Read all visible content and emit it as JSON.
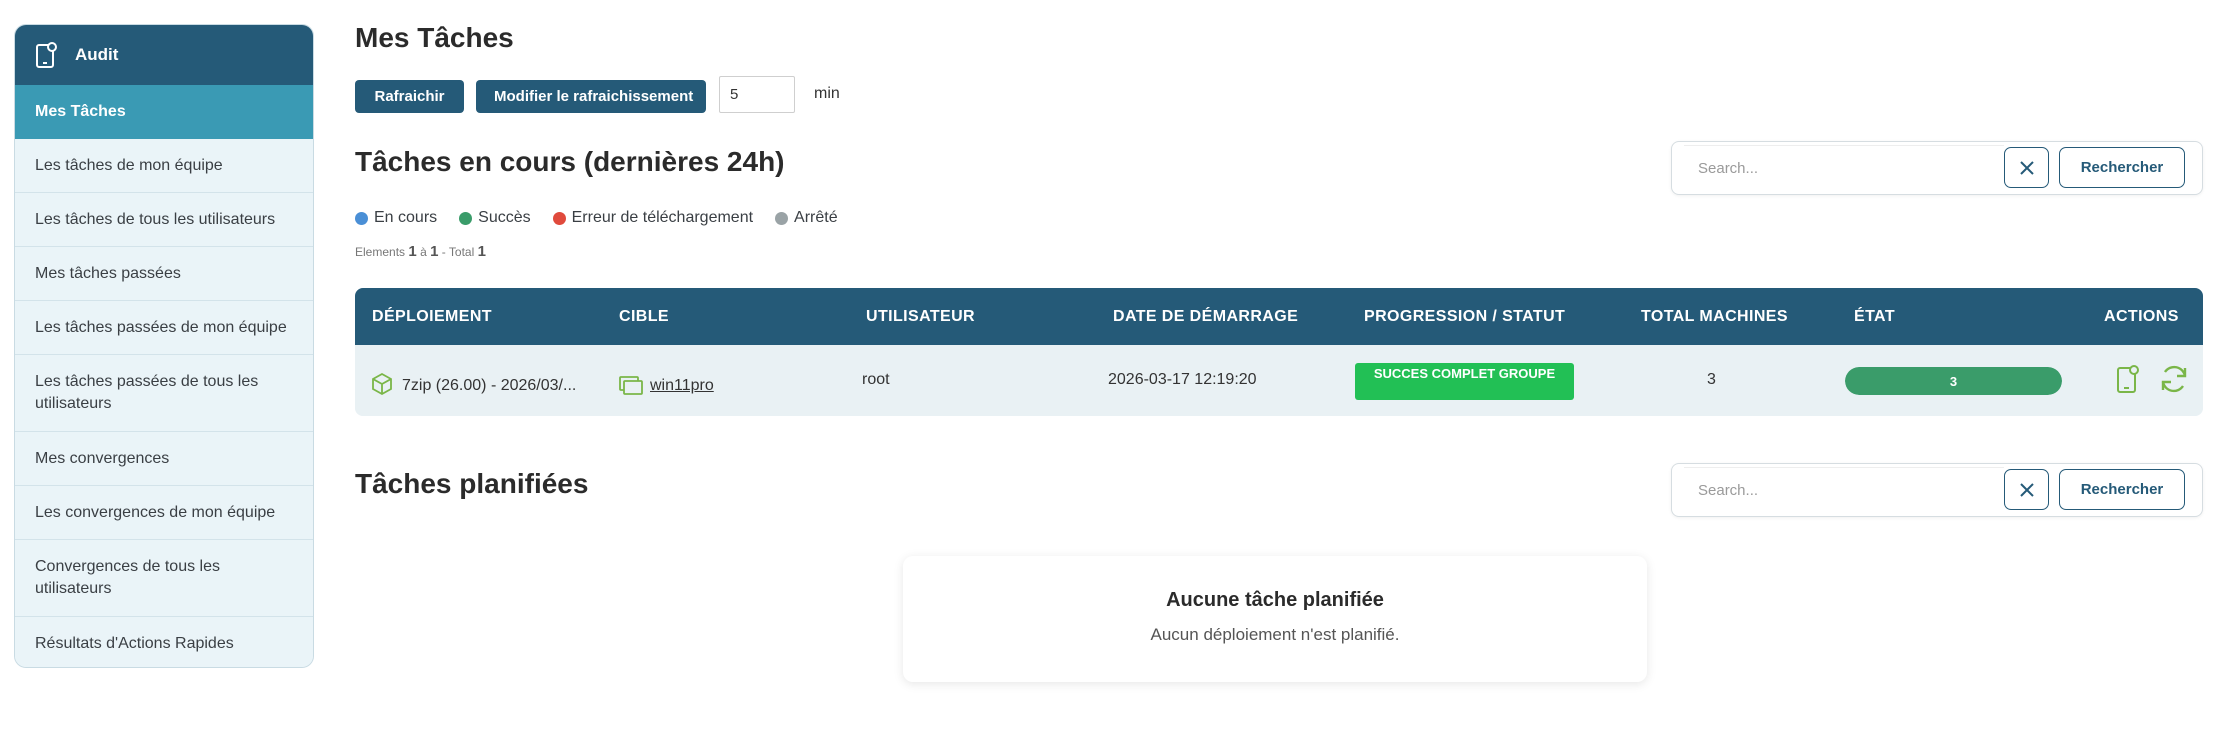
{
  "sidebar": {
    "header": {
      "label": "Audit",
      "icon": "audit-device-icon"
    },
    "items": [
      {
        "label": "Mes Tâches",
        "active": true
      },
      {
        "label": "Les tâches de mon équipe"
      },
      {
        "label": "Les tâches de tous les utilisateurs"
      },
      {
        "label": "Mes tâches passées"
      },
      {
        "label": "Les tâches passées de mon équipe"
      },
      {
        "label": "Les tâches passées de tous les utilisateurs"
      },
      {
        "label": "Mes convergences"
      },
      {
        "label": "Les convergences de mon équipe"
      },
      {
        "label": "Convergences de tous les utilisateurs"
      },
      {
        "label": "Résultats d'Actions Rapides"
      }
    ]
  },
  "page": {
    "title": "Mes Tâches",
    "refresh_label": "Rafraichir",
    "modify_refresh_label": "Modifier le rafraichissement",
    "refresh_value": "5",
    "refresh_unit": "min"
  },
  "running": {
    "title": "Tâches en cours (dernières 24h)",
    "legend": [
      {
        "label": "En cours",
        "color": "#4a8fd6"
      },
      {
        "label": "Succès",
        "color": "#3a9c6a"
      },
      {
        "label": "Erreur de téléchargement",
        "color": "#e04a3c"
      },
      {
        "label": "Arrêté",
        "color": "#9aa3a6"
      }
    ],
    "count": {
      "prefix": "Elements",
      "from": "1",
      "sep": "à",
      "to": "1",
      "total_label": "- Total",
      "total": "1"
    },
    "search": {
      "placeholder": "Search...",
      "button": "Rechercher"
    },
    "columns": [
      "DÉPLOIEMENT",
      "CIBLE",
      "UTILISATEUR",
      "DATE DE DÉMARRAGE",
      "PROGRESSION / STATUT",
      "TOTAL MACHINES",
      "ÉTAT",
      "ACTIONS"
    ],
    "rows": [
      {
        "deployment": "7zip (26.00) - 2026/03/...",
        "target": "win11pro",
        "user": "root",
        "start_date": "2026-03-17 12:19:20",
        "status": "SUCCES COMPLET GROUPE",
        "total_machines": "3",
        "state_value": "3",
        "state_fraction": 1.0
      }
    ]
  },
  "planned": {
    "title": "Tâches planifiées",
    "search": {
      "placeholder": "Search...",
      "button": "Rechercher"
    },
    "empty_title": "Aucune tâche planifiée",
    "empty_sub": "Aucun déploiement n'est planifié."
  },
  "colors": {
    "primary": "#255a78",
    "active_item": "#3a9ab4",
    "success": "#22c055",
    "action_green": "#7ab648"
  }
}
